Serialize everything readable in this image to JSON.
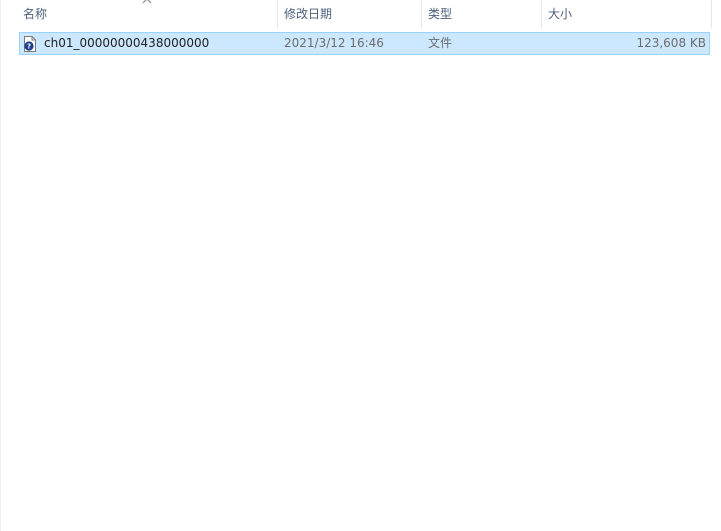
{
  "columns": {
    "name": "名称",
    "modified": "修改日期",
    "type": "类型",
    "size": "大小"
  },
  "sort": {
    "column": "name",
    "direction": "ascending",
    "icon": "sort-up-chevron"
  },
  "files": [
    {
      "name": "ch01_00000000438000000",
      "modified": "2021/3/12 16:46",
      "type": "文件",
      "size": "123,608 KB",
      "icon": "unknown-file-icon",
      "selected": true
    }
  ],
  "colors": {
    "selection_bg": "#cce8ff",
    "selection_border": "#99d1ff",
    "header_text": "#4c607a"
  }
}
